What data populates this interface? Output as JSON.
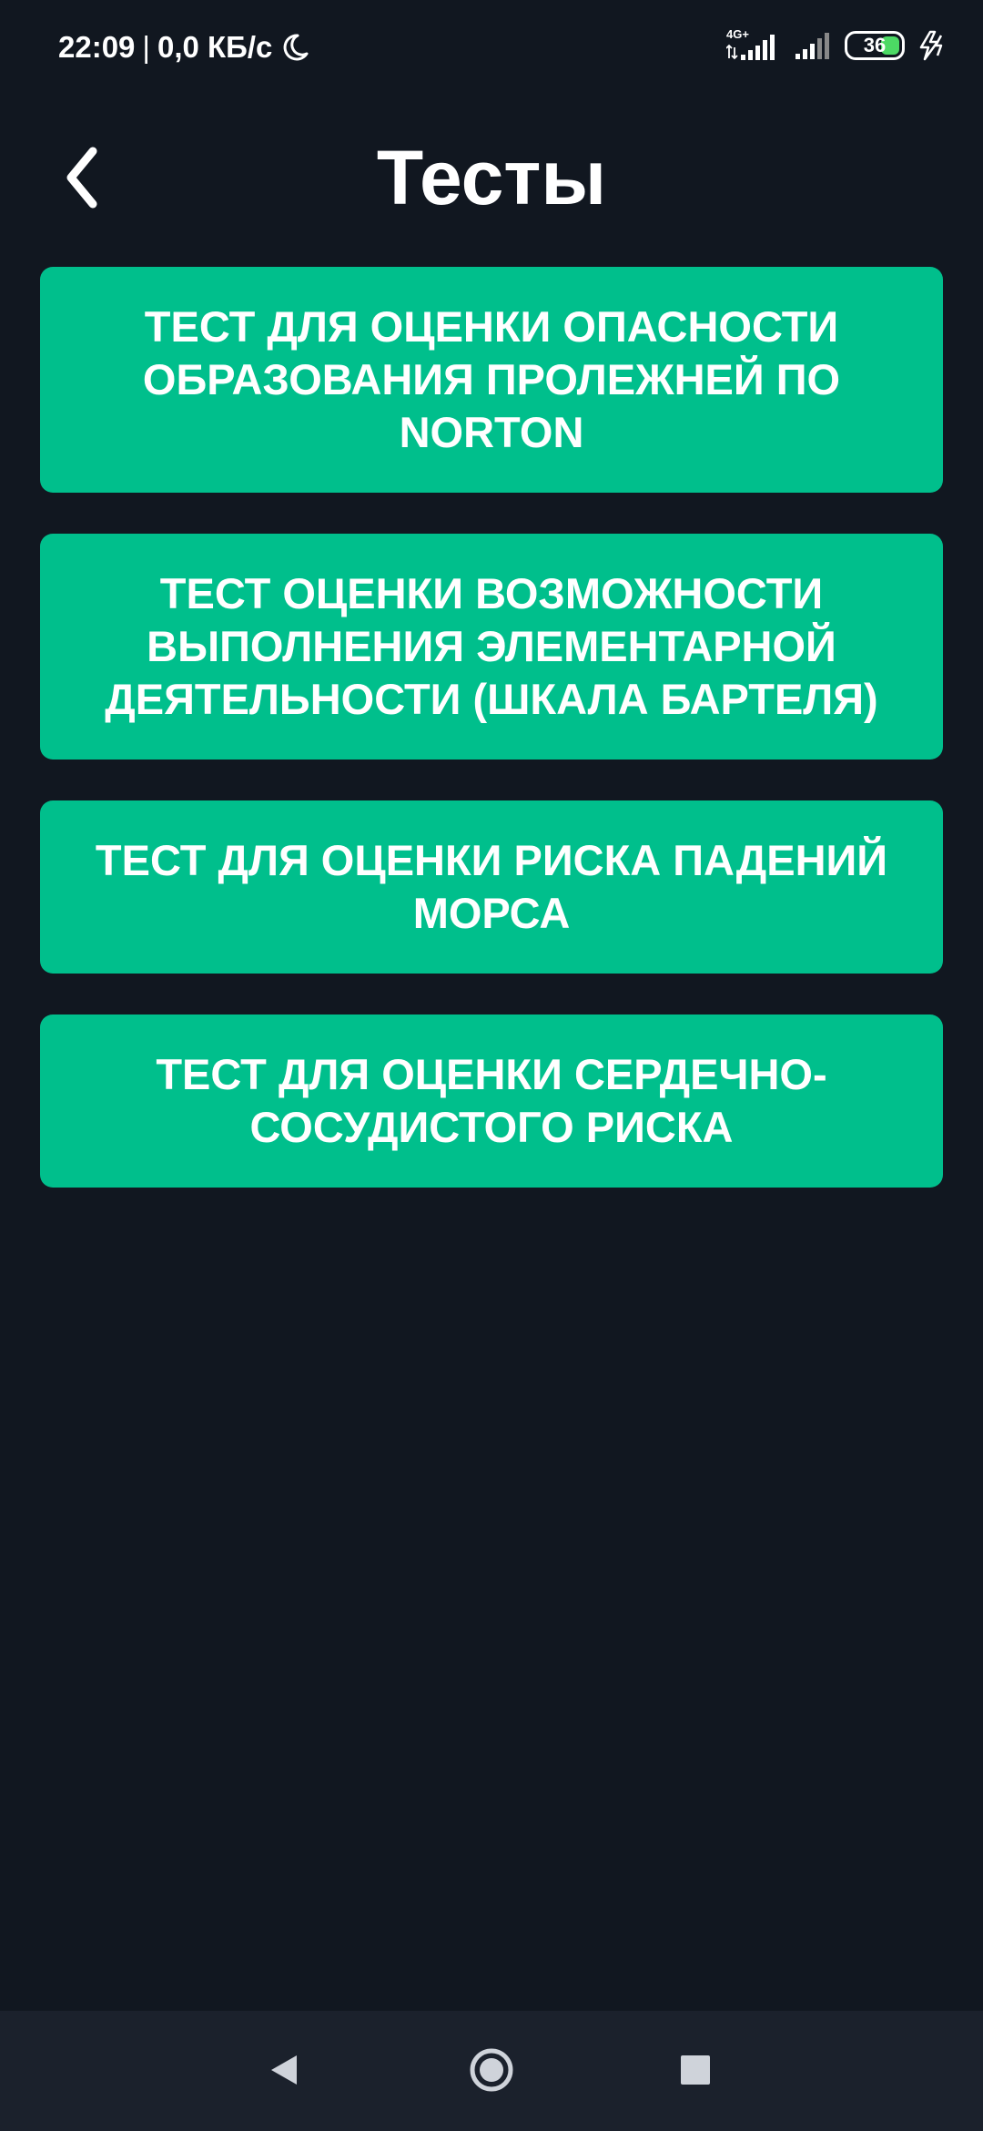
{
  "status_bar": {
    "time": "22:09",
    "separator": "|",
    "speed": "0,0 КБ/с",
    "network_type": "4G+",
    "battery": "36"
  },
  "header": {
    "title": "Тесты",
    "back_icon": "chevron-left-icon"
  },
  "tests": [
    {
      "label": "ТЕСТ ДЛЯ ОЦЕНКИ ОПАСНОСТИ ОБРАЗОВАНИЯ ПРОЛЕЖНЕЙ ПО NORTON"
    },
    {
      "label": "ТЕСТ ОЦЕНКИ ВОЗМОЖНОСТИ ВЫПОЛНЕНИЯ ЭЛЕМЕНТАРНОЙ ДЕЯТЕЛЬНОСТИ (ШКАЛА БАРТЕЛЯ)"
    },
    {
      "label": "ТЕСТ ДЛЯ ОЦЕНКИ РИСКА ПАДЕНИЙ МОРСА"
    },
    {
      "label": "ТЕСТ ДЛЯ ОЦЕНКИ СЕРДЕЧНО-СОСУДИСТОГО РИСКА"
    }
  ],
  "nav_bar": {
    "back_icon": "triangle-back-icon",
    "home_icon": "circle-home-icon",
    "recents_icon": "square-recents-icon"
  },
  "colors": {
    "background": "#111720",
    "button": "#00bf8c",
    "nav_bar": "#1b212c",
    "text": "#ffffff"
  }
}
